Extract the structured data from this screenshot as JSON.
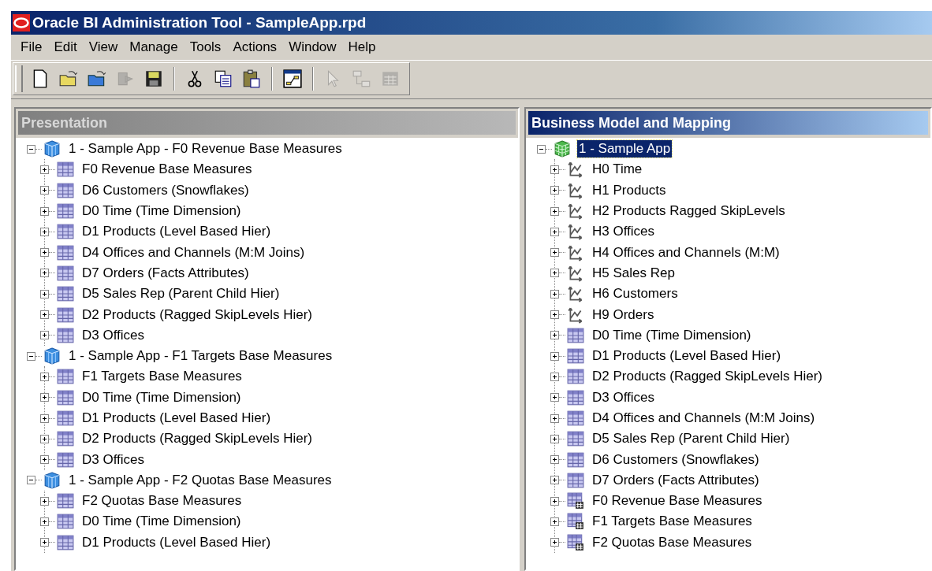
{
  "window": {
    "title": "Oracle BI Administration Tool - SampleApp.rpd"
  },
  "menu": [
    "File",
    "Edit",
    "View",
    "Manage",
    "Tools",
    "Actions",
    "Window",
    "Help"
  ],
  "toolbar": [
    [
      {
        "kind": "new",
        "disabled": false
      },
      {
        "kind": "open",
        "disabled": false
      },
      {
        "kind": "open-online",
        "disabled": false
      },
      {
        "kind": "check-in",
        "disabled": true
      },
      {
        "kind": "save",
        "disabled": false
      }
    ],
    [
      {
        "kind": "cut",
        "disabled": false
      },
      {
        "kind": "copy",
        "disabled": false
      },
      {
        "kind": "paste",
        "disabled": false
      }
    ],
    [
      {
        "kind": "diagram",
        "disabled": false
      }
    ],
    [
      {
        "kind": "select",
        "disabled": true
      },
      {
        "kind": "join",
        "disabled": true
      },
      {
        "kind": "table",
        "disabled": true
      }
    ]
  ],
  "panes": [
    {
      "title": "Presentation",
      "active": false,
      "tree": [
        {
          "label": "1 - Sample App - F0 Revenue Base Measures",
          "kind": "subject-area",
          "expanded": true,
          "selected": false,
          "children": [
            {
              "label": "F0 Revenue Base Measures",
              "kind": "table",
              "expanded": false,
              "selected": false
            },
            {
              "label": "D6 Customers (Snowflakes)",
              "kind": "table",
              "expanded": false,
              "selected": false
            },
            {
              "label": "D0 Time (Time Dimension)",
              "kind": "table",
              "expanded": false,
              "selected": false
            },
            {
              "label": "D1 Products (Level Based Hier)",
              "kind": "table",
              "expanded": false,
              "selected": false
            },
            {
              "label": "D4 Offices and Channels (M:M Joins)",
              "kind": "table",
              "expanded": false,
              "selected": false
            },
            {
              "label": "D7 Orders (Facts Attributes)",
              "kind": "table",
              "expanded": false,
              "selected": false
            },
            {
              "label": "D5 Sales Rep (Parent Child Hier)",
              "kind": "table",
              "expanded": false,
              "selected": false
            },
            {
              "label": "D2 Products (Ragged SkipLevels Hier)",
              "kind": "table",
              "expanded": false,
              "selected": false
            },
            {
              "label": "D3 Offices",
              "kind": "table",
              "expanded": false,
              "selected": false
            }
          ]
        },
        {
          "label": "1 - Sample App - F1 Targets Base Measures",
          "kind": "subject-area",
          "expanded": true,
          "selected": false,
          "children": [
            {
              "label": "F1 Targets Base Measures",
              "kind": "table",
              "expanded": false,
              "selected": false
            },
            {
              "label": "D0 Time (Time Dimension)",
              "kind": "table",
              "expanded": false,
              "selected": false
            },
            {
              "label": "D1 Products (Level Based Hier)",
              "kind": "table",
              "expanded": false,
              "selected": false
            },
            {
              "label": "D2 Products (Ragged SkipLevels Hier)",
              "kind": "table",
              "expanded": false,
              "selected": false
            },
            {
              "label": "D3 Offices",
              "kind": "table",
              "expanded": false,
              "selected": false
            }
          ]
        },
        {
          "label": "1 - Sample App - F2 Quotas Base Measures",
          "kind": "subject-area",
          "expanded": true,
          "selected": false,
          "children": [
            {
              "label": "F2 Quotas Base Measures",
              "kind": "table",
              "expanded": false,
              "selected": false
            },
            {
              "label": "D0 Time (Time Dimension)",
              "kind": "table",
              "expanded": false,
              "selected": false
            },
            {
              "label": "D1 Products (Level Based Hier)",
              "kind": "table",
              "expanded": false,
              "selected": false
            }
          ]
        }
      ]
    },
    {
      "title": "Business Model and Mapping",
      "active": true,
      "tree": [
        {
          "label": "1 - Sample App",
          "kind": "business-model",
          "expanded": true,
          "selected": true,
          "children": [
            {
              "label": "H0 Time",
              "kind": "hierarchy",
              "expanded": false,
              "selected": false
            },
            {
              "label": "H1 Products",
              "kind": "hierarchy",
              "expanded": false,
              "selected": false
            },
            {
              "label": "H2 Products Ragged SkipLevels",
              "kind": "hierarchy",
              "expanded": false,
              "selected": false
            },
            {
              "label": "H3 Offices",
              "kind": "hierarchy",
              "expanded": false,
              "selected": false
            },
            {
              "label": "H4 Offices and Channels (M:M)",
              "kind": "hierarchy",
              "expanded": false,
              "selected": false
            },
            {
              "label": "H5 Sales Rep",
              "kind": "hierarchy",
              "expanded": false,
              "selected": false
            },
            {
              "label": "H6 Customers",
              "kind": "hierarchy",
              "expanded": false,
              "selected": false
            },
            {
              "label": "H9 Orders",
              "kind": "hierarchy",
              "expanded": false,
              "selected": false
            },
            {
              "label": "D0 Time (Time Dimension)",
              "kind": "table",
              "expanded": false,
              "selected": false
            },
            {
              "label": "D1 Products (Level Based Hier)",
              "kind": "table",
              "expanded": false,
              "selected": false
            },
            {
              "label": "D2 Products (Ragged SkipLevels Hier)",
              "kind": "table",
              "expanded": false,
              "selected": false
            },
            {
              "label": "D3 Offices",
              "kind": "table",
              "expanded": false,
              "selected": false
            },
            {
              "label": "D4 Offices and Channels (M:M Joins)",
              "kind": "table",
              "expanded": false,
              "selected": false
            },
            {
              "label": "D5 Sales Rep (Parent Child Hier)",
              "kind": "table",
              "expanded": false,
              "selected": false
            },
            {
              "label": "D6 Customers (Snowflakes)",
              "kind": "table",
              "expanded": false,
              "selected": false
            },
            {
              "label": "D7 Orders (Facts Attributes)",
              "kind": "table",
              "expanded": false,
              "selected": false
            },
            {
              "label": "F0 Revenue Base Measures",
              "kind": "fact-table",
              "expanded": false,
              "selected": false
            },
            {
              "label": "F1 Targets Base Measures",
              "kind": "fact-table",
              "expanded": false,
              "selected": false
            },
            {
              "label": "F2 Quotas Base Measures",
              "kind": "fact-table",
              "expanded": false,
              "selected": false
            }
          ]
        }
      ]
    }
  ]
}
